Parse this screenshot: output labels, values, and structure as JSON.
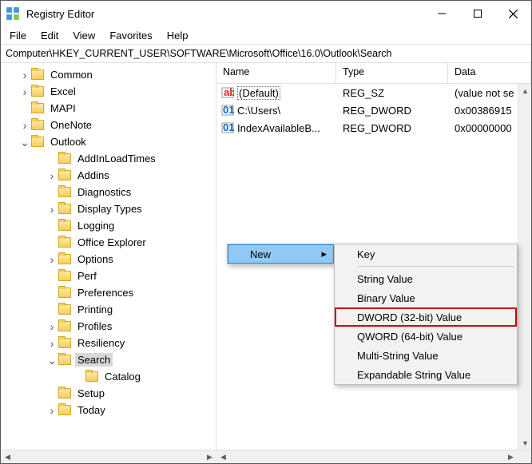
{
  "title": "Registry Editor",
  "menus": [
    "File",
    "Edit",
    "View",
    "Favorites",
    "Help"
  ],
  "path": "Computer\\HKEY_CURRENT_USER\\SOFTWARE\\Microsoft\\Office\\16.0\\Outlook\\Search",
  "tree": {
    "common": "Common",
    "excel": "Excel",
    "mapi": "MAPI",
    "onenote": "OneNote",
    "outlook": "Outlook",
    "addinloadtimes": "AddInLoadTimes",
    "addins": "Addins",
    "diagnostics": "Diagnostics",
    "displaytypes": "Display Types",
    "logging": "Logging",
    "officeexplorer": "Office Explorer",
    "options": "Options",
    "perf": "Perf",
    "preferences": "Preferences",
    "printing": "Printing",
    "profiles": "Profiles",
    "resiliency": "Resiliency",
    "search": "Search",
    "catalog": "Catalog",
    "setup": "Setup",
    "today": "Today"
  },
  "list": {
    "headers": {
      "name": "Name",
      "type": "Type",
      "data": "Data"
    },
    "rows": [
      {
        "name": "(Default)",
        "type": "REG_SZ",
        "data": "(value not se"
      },
      {
        "name": "C:\\Users\\",
        "type": "REG_DWORD",
        "data": "0x00386915"
      },
      {
        "name": "IndexAvailableB...",
        "type": "REG_DWORD",
        "data": "0x00000000"
      }
    ]
  },
  "ctx1": {
    "new": "New"
  },
  "ctx2": {
    "key": "Key",
    "string": "String Value",
    "binary": "Binary Value",
    "dword": "DWORD (32-bit) Value",
    "qword": "QWORD (64-bit) Value",
    "multi": "Multi-String Value",
    "expand": "Expandable String Value"
  }
}
